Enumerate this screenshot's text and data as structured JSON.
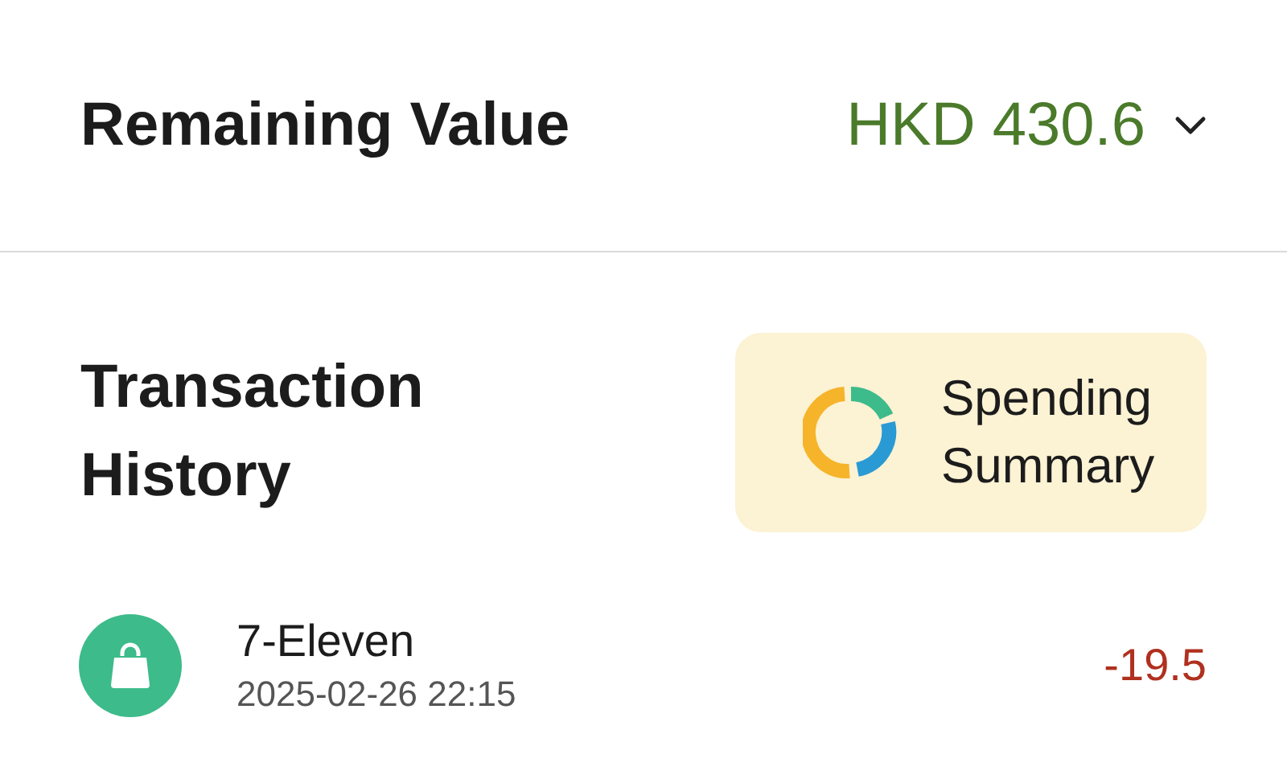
{
  "balance": {
    "label": "Remaining Value",
    "value": "HKD 430.6"
  },
  "history": {
    "title": "Transaction\nHistory",
    "summary_button": "Spending\nSummary"
  },
  "transactions": [
    {
      "merchant": "7-Eleven",
      "time": "2025-02-26 22:15",
      "amount": "-19.5"
    }
  ]
}
